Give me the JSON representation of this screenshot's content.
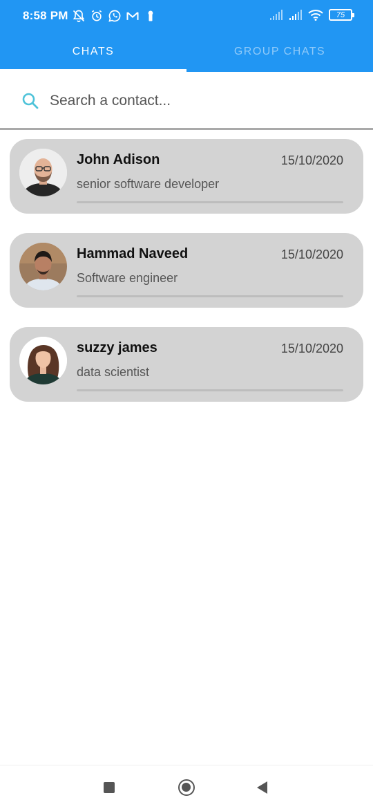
{
  "status_bar": {
    "time": "8:58 PM",
    "battery": "75",
    "left_icons": [
      "mute-bell-icon",
      "alarm-icon",
      "whatsapp-icon",
      "gmail-icon",
      "keyhole-icon"
    ],
    "right_icons": [
      "signal-icon",
      "signal-icon",
      "wifi-icon",
      "battery-icon"
    ]
  },
  "tabs": [
    {
      "label": "CHATS",
      "active": true
    },
    {
      "label": "GROUP CHATS",
      "active": false
    }
  ],
  "search": {
    "placeholder": "Search a contact...",
    "value": "",
    "icon": "search-icon"
  },
  "chats": [
    {
      "name": "John Adison",
      "subtitle": "senior software developer",
      "date": "15/10/2020",
      "avatar": "avatar-bald-man-glasses"
    },
    {
      "name": "Hammad Naveed",
      "subtitle": "Software engineer",
      "date": "15/10/2020",
      "avatar": "avatar-man-dark-hair"
    },
    {
      "name": "suzzy james",
      "subtitle": "data scientist",
      "date": "15/10/2020",
      "avatar": "avatar-woman-curly-hair"
    }
  ],
  "nav_bar": {
    "icons": [
      "recents-icon",
      "home-icon",
      "back-icon"
    ]
  },
  "colors": {
    "primary": "#2196f3",
    "card": "#d3d3d3",
    "search_icon": "#4fc3d9"
  }
}
